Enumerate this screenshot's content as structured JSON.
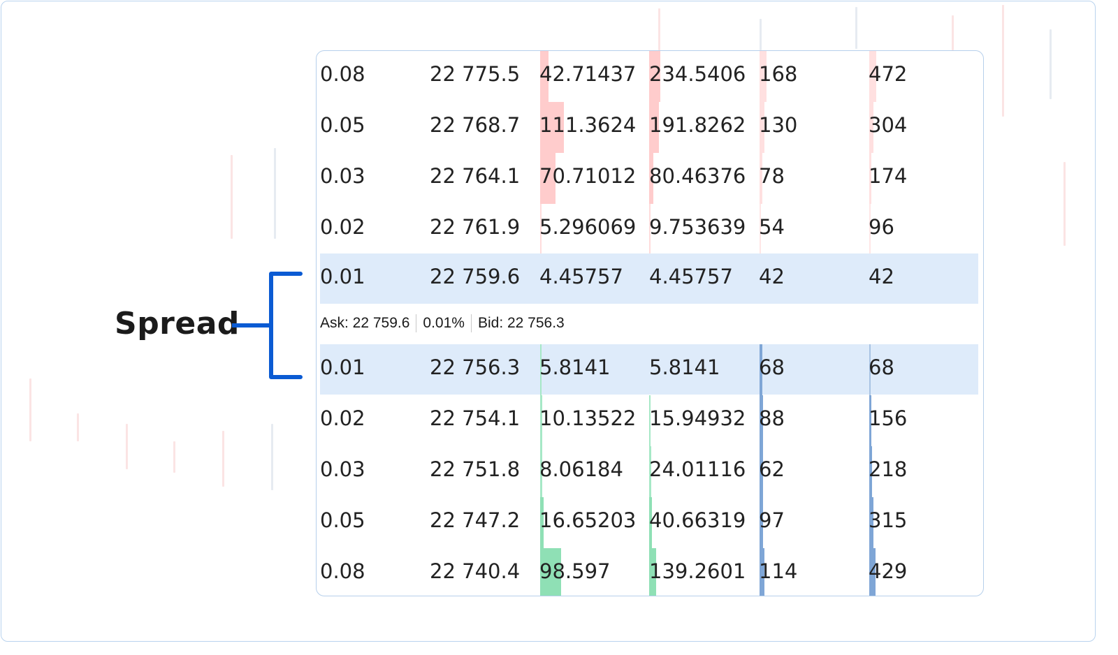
{
  "annotation": {
    "label": "Spread",
    "color": "#0b5bd3"
  },
  "spread_info": {
    "ask": "Ask: 22 759.6",
    "pct": "0.01%",
    "bid": "Bid: 22 756.3"
  },
  "colors": {
    "ask_bar": "#ffcccc",
    "bid_green_bar": "#8fe0b5",
    "bid_blue_bar": "#7fa6d6",
    "highlight": "#deebfa"
  },
  "asks": [
    {
      "c1": "0.08",
      "price": "22 775.5",
      "size": "42.71437",
      "total": "234.5406",
      "count": "168",
      "total_count": "472"
    },
    {
      "c1": "0.05",
      "price": "22 768.7",
      "size": "111.3624",
      "total": "191.8262",
      "count": "130",
      "total_count": "304"
    },
    {
      "c1": "0.03",
      "price": "22 764.1",
      "size": "70.71012",
      "total": "80.46376",
      "count": "78",
      "total_count": "174"
    },
    {
      "c1": "0.02",
      "price": "22 761.9",
      "size": "5.296069",
      "total": "9.753639",
      "count": "54",
      "total_count": "96"
    },
    {
      "c1": "0.01",
      "price": "22 759.6",
      "size": "4.45757",
      "total": "4.45757",
      "count": "42",
      "total_count": "42"
    }
  ],
  "bids": [
    {
      "c1": "0.01",
      "price": "22 756.3",
      "size": "5.8141",
      "total": "5.8141",
      "count": "68",
      "total_count": "68"
    },
    {
      "c1": "0.02",
      "price": "22 754.1",
      "size": "10.13522",
      "total": "15.94932",
      "count": "88",
      "total_count": "156"
    },
    {
      "c1": "0.03",
      "price": "22 751.8",
      "size": "8.06184",
      "total": "24.01116",
      "count": "62",
      "total_count": "218"
    },
    {
      "c1": "0.05",
      "price": "22 747.2",
      "size": "16.65203",
      "total": "40.66319",
      "count": "97",
      "total_count": "315"
    },
    {
      "c1": "0.08",
      "price": "22 740.4",
      "size": "98.597",
      "total": "139.2601",
      "count": "114",
      "total_count": "429"
    }
  ]
}
